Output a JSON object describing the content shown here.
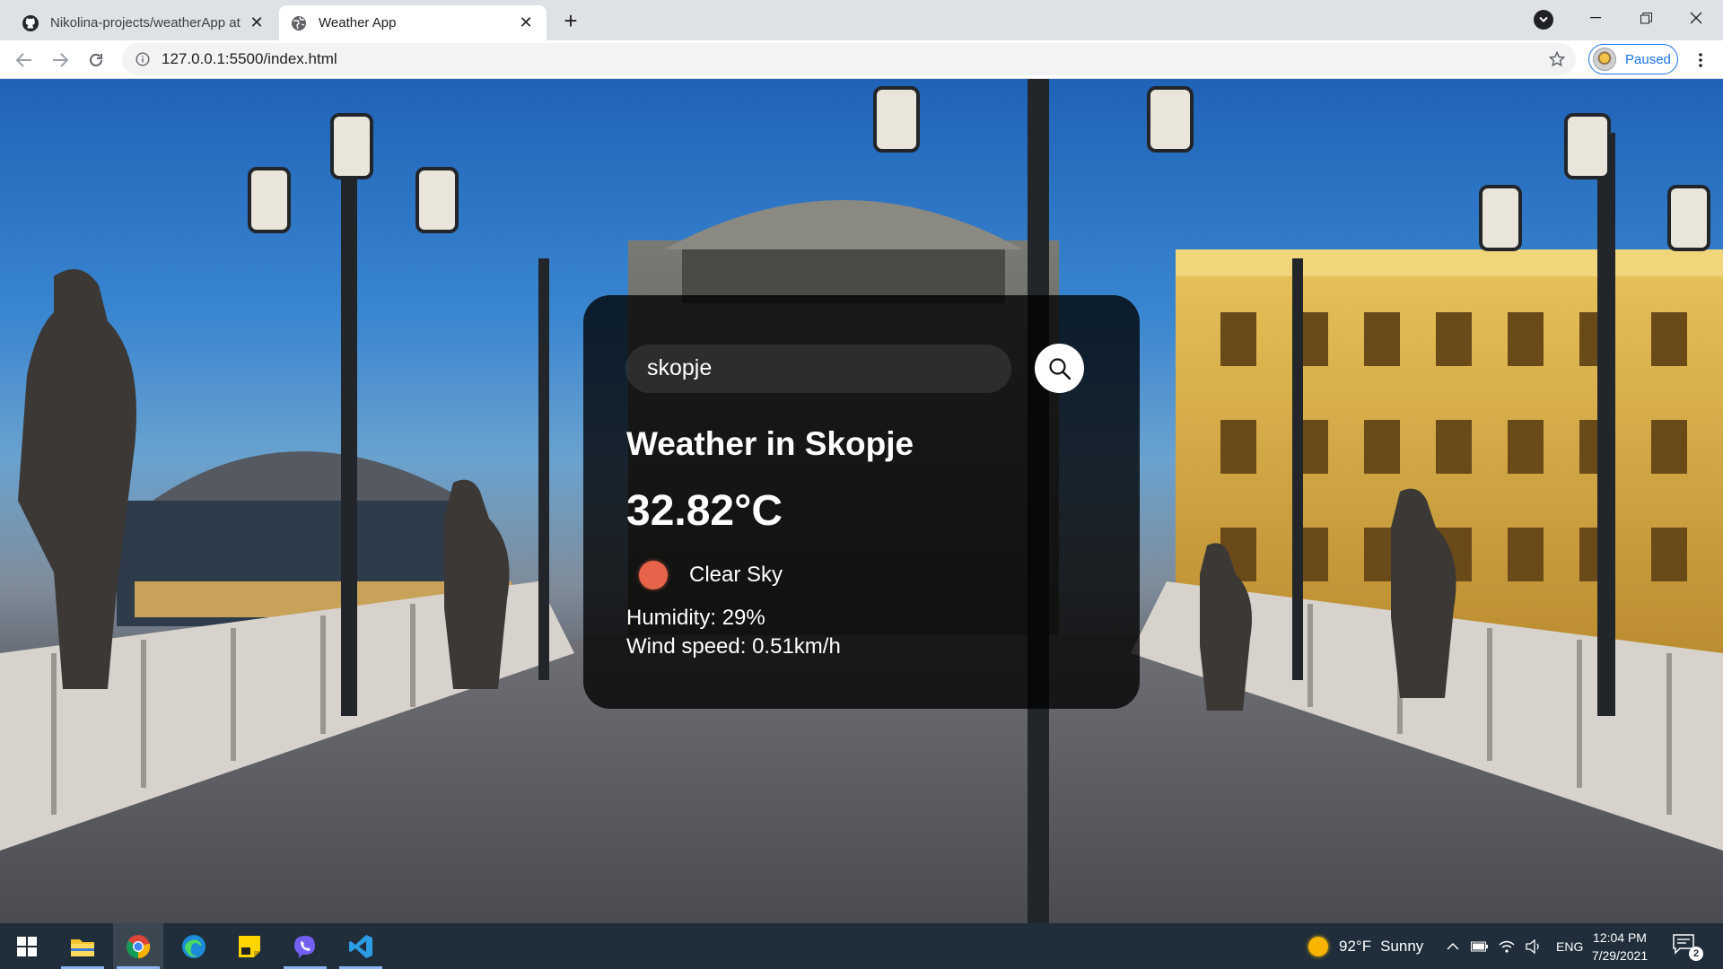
{
  "browser": {
    "tabs": [
      {
        "title": "Nikolina-projects/weatherApp at",
        "favicon": "github-icon",
        "active": false
      },
      {
        "title": "Weather App",
        "favicon": "globe-icon",
        "active": true
      }
    ],
    "address": "127.0.0.1:5500/index.html",
    "profile_status": "Paused"
  },
  "app": {
    "search_value": "skopje",
    "city_heading": "Weather in Skopje",
    "temperature": "32.82°C",
    "description": "Clear Sky",
    "humidity": "Humidity: 29%",
    "wind": "Wind speed: 0.51km/h",
    "icon": "sun-icon",
    "icon_color": "#e7644a"
  },
  "taskbar": {
    "apps": [
      "windows-start-icon",
      "file-explorer-icon",
      "chrome-icon",
      "edge-icon",
      "sticky-notes-icon",
      "viber-icon",
      "vscode-icon"
    ],
    "weather": {
      "temperature": "92°F",
      "condition": "Sunny"
    },
    "language": "ENG",
    "time": "12:04 PM",
    "date": "7/29/2021",
    "notifications": "2"
  },
  "colors": {
    "card_background": "rgba(0,0,0,0.78)",
    "taskbar": "#1f2e3a",
    "chrome_accent": "#1a73e8"
  }
}
